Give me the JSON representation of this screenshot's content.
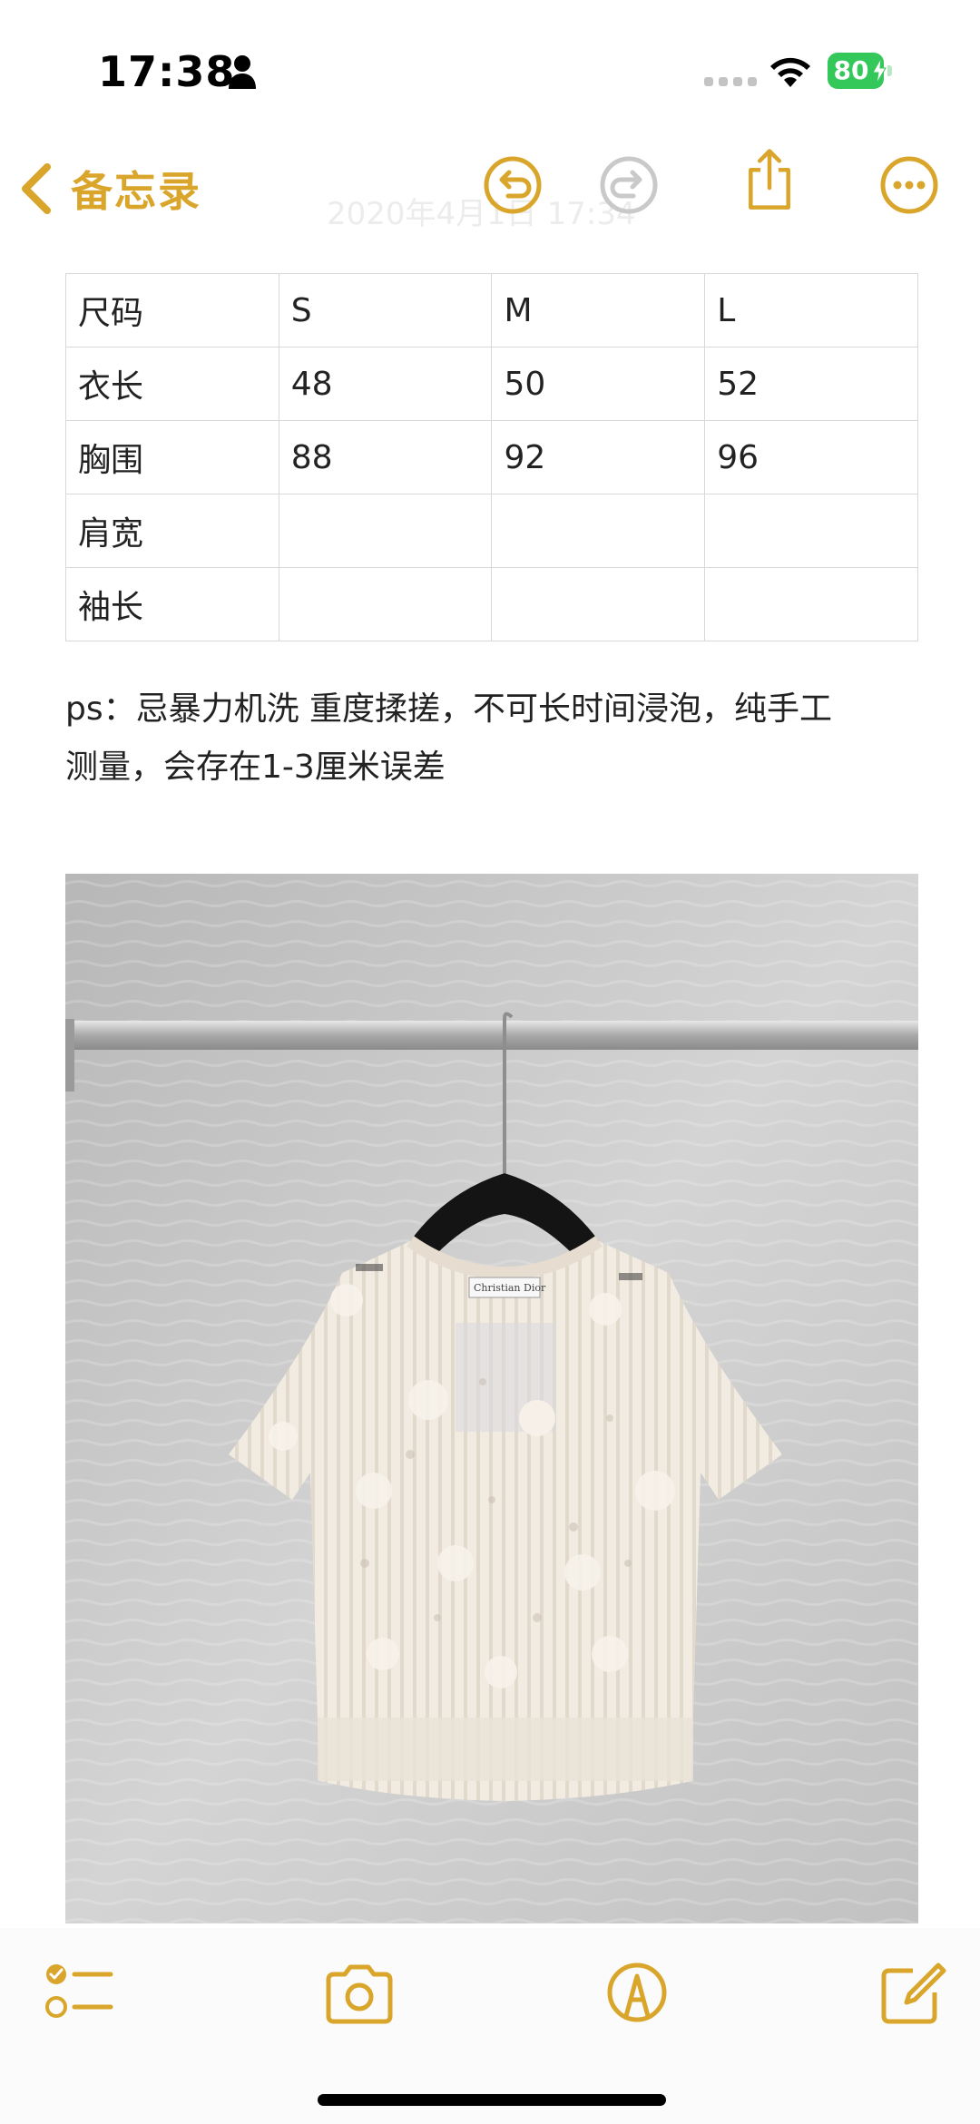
{
  "status_bar": {
    "time": "17:38",
    "battery": "80"
  },
  "nav": {
    "back_label": "备忘录",
    "faded_date": "2020年4月1日 17:34"
  },
  "size_table": {
    "rows": [
      [
        "尺码",
        "S",
        "M",
        "L"
      ],
      [
        "衣长",
        "48",
        "50",
        "52"
      ],
      [
        "胸围",
        "88",
        "92",
        "96"
      ],
      [
        "肩宽",
        "",
        "",
        ""
      ],
      [
        "袖长",
        "",
        "",
        ""
      ]
    ]
  },
  "note": {
    "line1": "ps：忌暴力机洗 重度揉搓，不可长时间浸泡，纯手工",
    "line2": "测量，会存在1-3厘米误差"
  },
  "photo": {
    "label_text": "Christian Dior"
  },
  "colors": {
    "accent": "#d9a62b",
    "battery_green": "#34c759"
  },
  "icons": [
    "person-icon",
    "signal-icon",
    "wifi-icon",
    "back-chevron-icon",
    "undo-icon",
    "redo-icon",
    "share-icon",
    "more-icon",
    "checklist-icon",
    "camera-icon",
    "markup-icon",
    "compose-icon"
  ]
}
